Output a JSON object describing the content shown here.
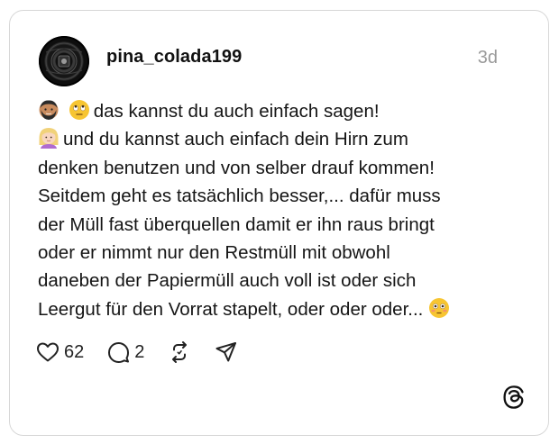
{
  "post": {
    "username": "pina_colada199",
    "timestamp": "3d",
    "lines": [
      "das kannst du auch einfach sagen!",
      "und du kannst auch einfach dein Hirn zum",
      "denken benutzen und von selber drauf kommen!",
      "Seitdem geht es tatsächlich besser,... dafür muss",
      "der Müll fast überquellen damit er ihn raus bringt",
      "oder er nimmt nur den Restmüll mit obwohl",
      "daneben der Papiermüll auch voll ist oder sich",
      "Leergut für den Vorrat stapelt, oder oder oder..."
    ],
    "emojis": [
      "man-bearded-emoji",
      "face-with-rolling-eyes-emoji",
      "woman-blond-emoji",
      "flushed-face-emoji"
    ]
  },
  "actions": {
    "like_count": "62",
    "reply_count": "2",
    "icons": [
      "heart-icon",
      "comment-icon",
      "repost-icon",
      "share-icon"
    ]
  },
  "branding": {
    "logo": "threads-logo-icon"
  },
  "colors": {
    "border": "#d7d7d7",
    "text": "#151515",
    "muted": "#9a9a9a",
    "emoji_yellow": "#f7c531"
  }
}
